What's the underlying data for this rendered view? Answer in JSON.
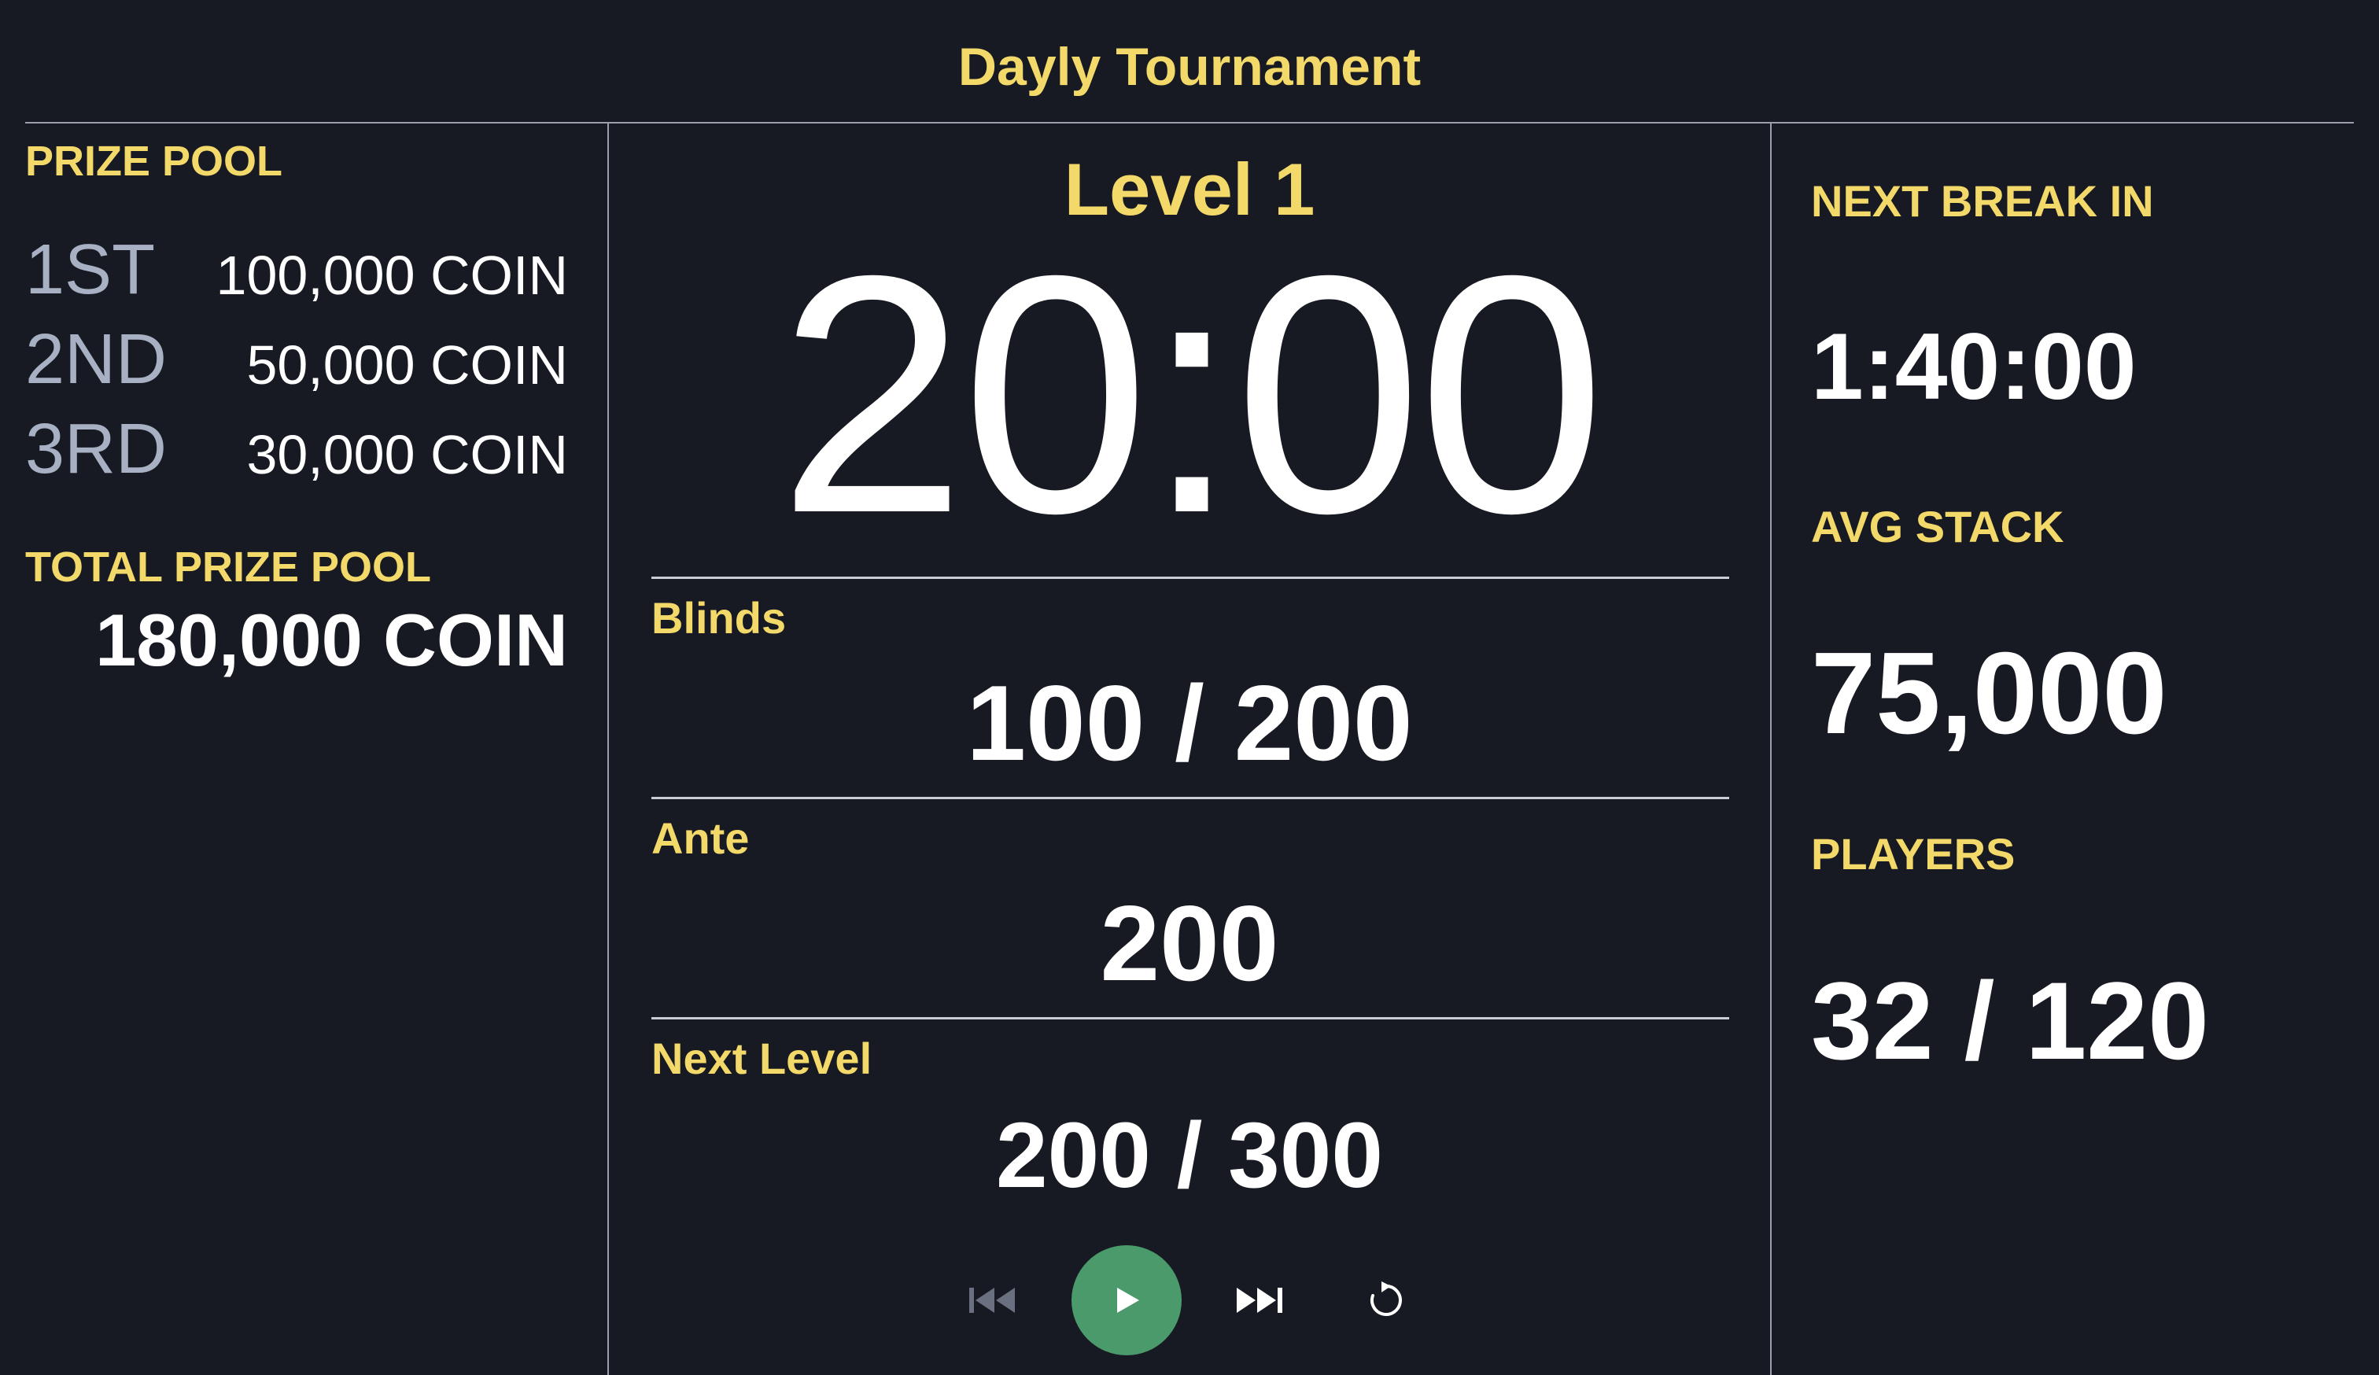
{
  "title": "Dayly Tournament",
  "prize_pool": {
    "label": "PRIZE POOL",
    "places": [
      {
        "place": "1ST",
        "amount": "100,000 COIN"
      },
      {
        "place": "2ND",
        "amount": "50,000 COIN"
      },
      {
        "place": "3RD",
        "amount": "30,000 COIN"
      }
    ],
    "total_label": "TOTAL PRIZE POOL",
    "total_value": "180,000 COIN"
  },
  "center": {
    "level": "Level 1",
    "timer": "20:00",
    "blinds_label": "Blinds",
    "blinds_value": "100 / 200",
    "ante_label": "Ante",
    "ante_value": "200",
    "next_level_label": "Next Level",
    "next_level_value": "200 / 300"
  },
  "controls": {
    "icons": [
      "skip-previous-icon",
      "play-icon",
      "skip-next-icon",
      "reset-icon"
    ],
    "play_color": "#4a9a6b"
  },
  "right": {
    "next_break_label": "NEXT BREAK IN",
    "next_break_value": "1:40:00",
    "avg_stack_label": "AVG STACK",
    "avg_stack_value": "75,000",
    "players_label": "PLAYERS",
    "players_value": "32 / 120"
  },
  "colors": {
    "background": "#171a22",
    "accent": "#f3d86a",
    "text": "#ffffff",
    "muted": "#a8b1c4"
  }
}
